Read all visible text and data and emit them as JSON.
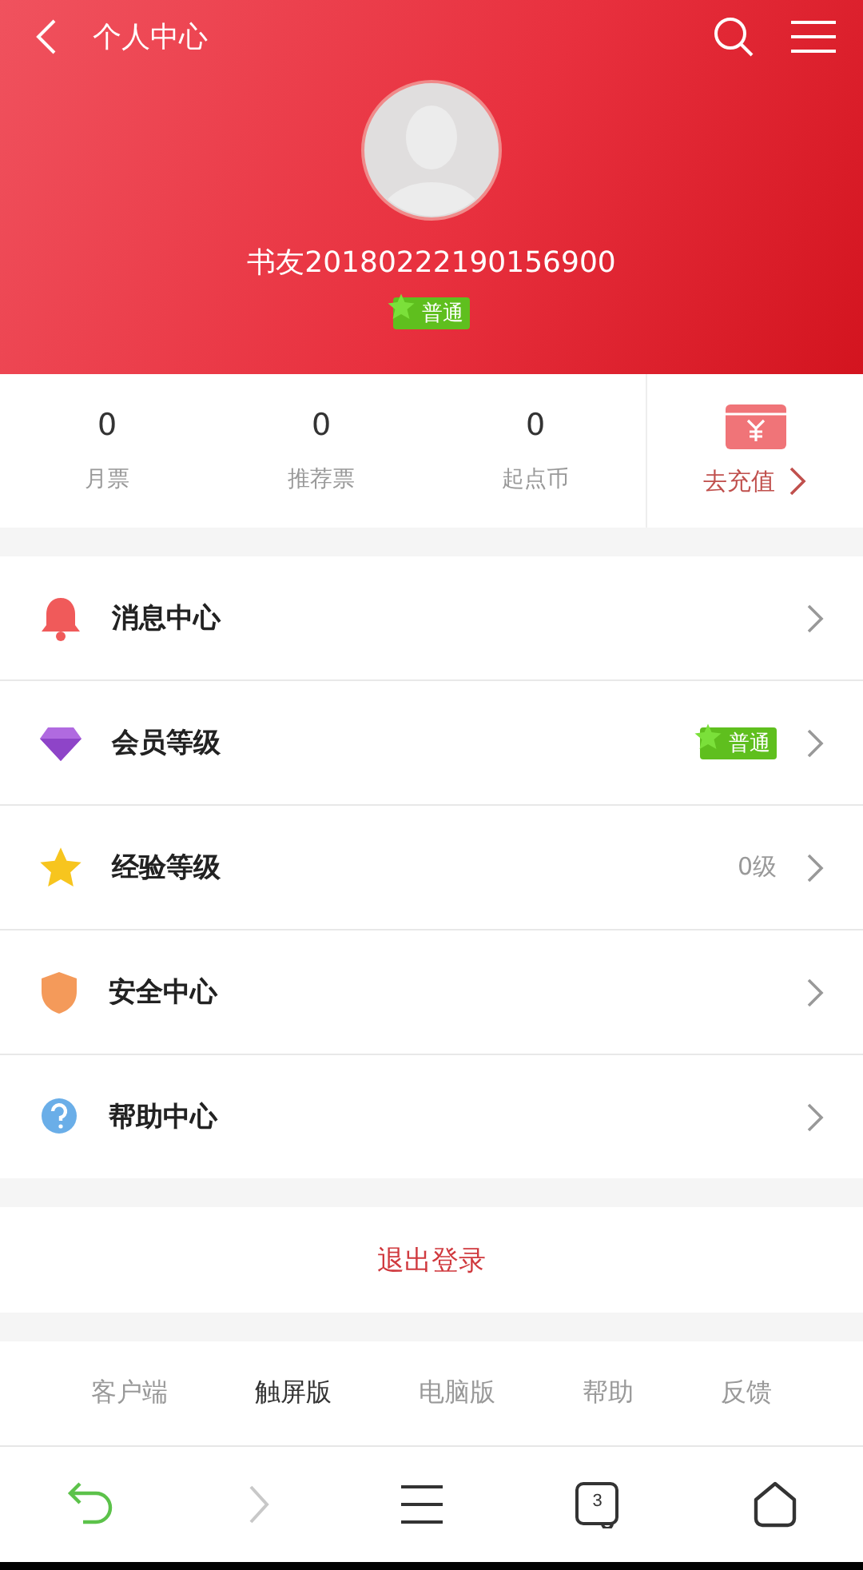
{
  "header": {
    "title": "个人中心",
    "username": "书友20180222190156900",
    "level_badge": "普通"
  },
  "stats": [
    {
      "value": "0",
      "label": "月票"
    },
    {
      "value": "0",
      "label": "推荐票"
    },
    {
      "value": "0",
      "label": "起点币"
    }
  ],
  "recharge": {
    "label": "去充值"
  },
  "menu": [
    {
      "label": "消息中心"
    },
    {
      "label": "会员等级",
      "badge": "普通"
    },
    {
      "label": "经验等级",
      "value": "0级"
    },
    {
      "label": "安全中心"
    },
    {
      "label": "帮助中心"
    }
  ],
  "logout": "退出登录",
  "footer_links": [
    {
      "label": "客户端",
      "selected": false
    },
    {
      "label": "触屏版",
      "selected": true
    },
    {
      "label": "电脑版",
      "selected": false
    },
    {
      "label": "帮助",
      "selected": false
    },
    {
      "label": "反馈",
      "selected": false
    }
  ],
  "toolbar": {
    "back_disabled": false,
    "forward_disabled": true,
    "tab_count": "3"
  }
}
